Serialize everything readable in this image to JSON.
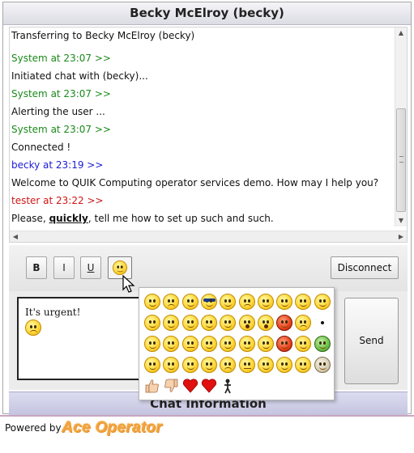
{
  "window": {
    "title": "Becky McElroy (becky)"
  },
  "transcript": {
    "intro": "Transferring to Becky McElroy (becky)",
    "messages": [
      {
        "sender": "System",
        "time": "23:07",
        "header": "System at 23:07 >>",
        "text": "Initiated chat with (becky)...",
        "kind": "system"
      },
      {
        "sender": "System",
        "time": "23:07",
        "header": "System at 23:07 >>",
        "text": "Alerting the user ...",
        "kind": "system"
      },
      {
        "sender": "System",
        "time": "23:07",
        "header": "System at 23:07 >>",
        "text": "Connected !",
        "kind": "system"
      },
      {
        "sender": "becky",
        "time": "23:19",
        "header": "becky at 23:19 >>",
        "text": "Welcome to QUIK Computing operator services demo. How may I help you?",
        "kind": "becky"
      },
      {
        "sender": "tester",
        "time": "23:22",
        "header": "tester at 23:22 >>",
        "text_before": "Please, ",
        "text_bold": "quickly",
        "text_after": ", tell me how to set up such and such.",
        "kind": "tester"
      }
    ]
  },
  "toolbar": {
    "bold_label": "B",
    "italic_label": "I",
    "underline_label": "U",
    "emoticon_button_icon": "smiley-icon",
    "disconnect_label": "Disconnect"
  },
  "composer": {
    "text": "It's urgent!",
    "inserted_emoticon": "frown-icon"
  },
  "send_label": "Send",
  "chat_info_label": "Chat Information",
  "emoticon_picker": {
    "rows": [
      [
        "smile",
        "frown",
        "smile",
        "cool",
        "smile",
        "worried",
        "grin",
        "kiss",
        "wink",
        "laugh"
      ],
      [
        "confused",
        "sleepy",
        "love",
        "smile",
        "smile",
        "surprised",
        "shocked",
        "devil",
        "sad",
        "dot"
      ],
      [
        "thinking",
        "smile",
        "neutral",
        "nerd",
        "tongue",
        "wave",
        "smile",
        "angry",
        "smile",
        "sick"
      ],
      [
        "wave2",
        "tongue-out",
        "silly",
        "puzzled",
        "sad2",
        "neutral2",
        "grin2",
        "smile2",
        "smile3",
        "yawn"
      ],
      [
        "thumbs-up",
        "thumbs-down",
        "heart",
        "heart",
        "stickman"
      ]
    ]
  },
  "footer": {
    "powered_by": "Powered by",
    "brand": "Ace Operator"
  },
  "colors": {
    "system": "#1b8a1b",
    "becky": "#1a1ad6",
    "tester": "#d01515",
    "brand": "#f2a33a"
  }
}
